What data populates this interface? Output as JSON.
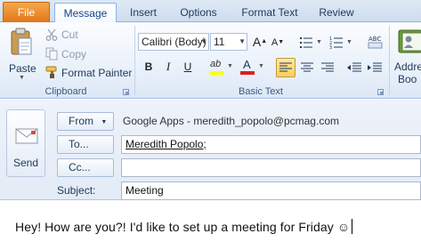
{
  "tabs": {
    "file": "File",
    "message": "Message",
    "insert": "Insert",
    "options": "Options",
    "format_text": "Format Text",
    "review": "Review"
  },
  "clipboard": {
    "paste": "Paste",
    "cut": "Cut",
    "copy": "Copy",
    "format_painter": "Format Painter",
    "group_label": "Clipboard"
  },
  "basic_text": {
    "font_name": "Calibri (Body)",
    "font_size": "11",
    "group_label": "Basic Text",
    "bold": "B",
    "italic": "I",
    "underline": "U",
    "font_color_letter": "A",
    "highlight_letters": "ab",
    "grow_font": "A",
    "shrink_font": "A",
    "alignment_selected": "left"
  },
  "names": {
    "address_book_line1": "Addre",
    "address_book_line2": "Boo"
  },
  "compose": {
    "send": "Send",
    "from_button": "From",
    "from_account": "Google Apps - meredith_popolo@pcmag.com",
    "to_button": "To...",
    "to_value": "Meredith Popolo;",
    "cc_button": "Cc...",
    "cc_value": "",
    "subject_label": "Subject:",
    "subject_value": "Meeting",
    "body": "Hey! How are you?! I'd like to set up a meeting for Friday ☺"
  },
  "colors": {
    "file_tab": "#e1761a",
    "ribbon_accent": "#8db2e3",
    "highlight_yellow": "#ffff00",
    "font_color_red": "#e31b1b",
    "selected_button": "#f8cf5c"
  }
}
